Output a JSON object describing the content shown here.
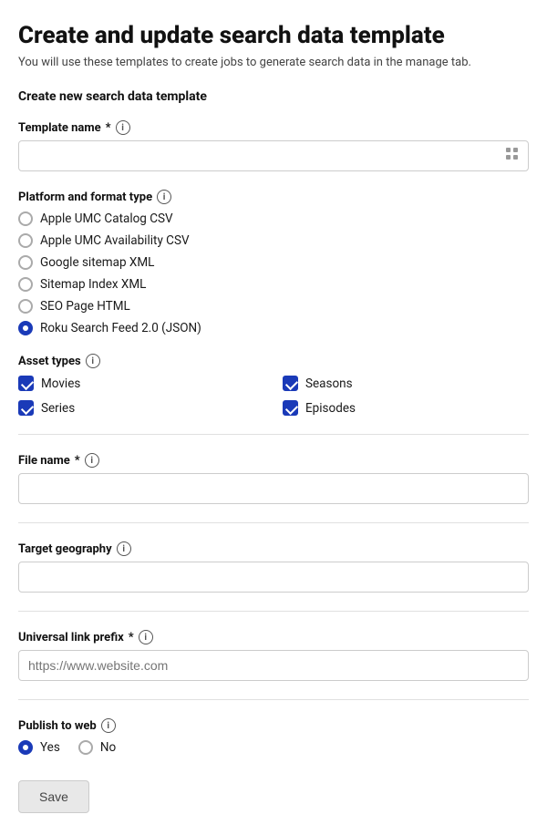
{
  "page": {
    "title": "Create and update search data template",
    "subtitle": "You will use these templates to create jobs to generate search data in the manage tab.",
    "section_title": "Create new search data template"
  },
  "template_name": {
    "label": "Template name",
    "required": true,
    "value": "",
    "placeholder": ""
  },
  "platform": {
    "label": "Platform and format type",
    "options": [
      {
        "id": "apple-umc-csv",
        "label": "Apple UMC Catalog CSV",
        "checked": false
      },
      {
        "id": "apple-umc-avail",
        "label": "Apple UMC Availability CSV",
        "checked": false
      },
      {
        "id": "google-sitemap",
        "label": "Google sitemap XML",
        "checked": false
      },
      {
        "id": "sitemap-index",
        "label": "Sitemap Index XML",
        "checked": false
      },
      {
        "id": "seo-page",
        "label": "SEO Page HTML",
        "checked": false
      },
      {
        "id": "roku-search",
        "label": "Roku Search Feed 2.0 (JSON)",
        "checked": true
      }
    ]
  },
  "asset_types": {
    "label": "Asset types",
    "items": [
      {
        "id": "movies",
        "label": "Movies",
        "checked": true
      },
      {
        "id": "seasons",
        "label": "Seasons",
        "checked": true
      },
      {
        "id": "series",
        "label": "Series",
        "checked": true
      },
      {
        "id": "episodes",
        "label": "Episodes",
        "checked": true
      }
    ]
  },
  "file_name": {
    "label": "File name",
    "required": true,
    "value": "",
    "placeholder": ""
  },
  "target_geography": {
    "label": "Target geography",
    "value": "",
    "placeholder": ""
  },
  "universal_link_prefix": {
    "label": "Universal link prefix",
    "required": true,
    "value": "",
    "placeholder": "https://www.website.com"
  },
  "publish_to_web": {
    "label": "Publish to web",
    "options": [
      {
        "id": "yes",
        "label": "Yes",
        "checked": true
      },
      {
        "id": "no",
        "label": "No",
        "checked": false
      }
    ]
  },
  "save_button": {
    "label": "Save"
  }
}
